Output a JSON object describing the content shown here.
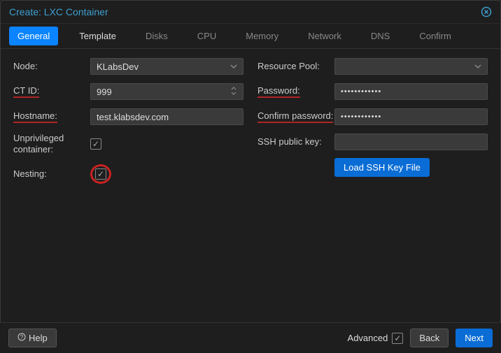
{
  "header": {
    "title": "Create: LXC Container"
  },
  "tabs": [
    "General",
    "Template",
    "Disks",
    "CPU",
    "Memory",
    "Network",
    "DNS",
    "Confirm"
  ],
  "activeTab": 0,
  "enabledTabs": [
    0,
    1
  ],
  "left": {
    "node": {
      "label": "Node:",
      "value": "KLabsDev"
    },
    "ctid": {
      "label": "CT ID:",
      "value": "999"
    },
    "hostname": {
      "label": "Hostname:",
      "value": "test.klabsdev.com"
    },
    "unpriv": {
      "label": "Unprivileged container:",
      "checked": true
    },
    "nesting": {
      "label": "Nesting:",
      "checked": true
    }
  },
  "right": {
    "pool": {
      "label": "Resource Pool:",
      "value": ""
    },
    "password": {
      "label": "Password:",
      "value": "••••••••••••"
    },
    "confirm": {
      "label": "Confirm password:",
      "value": "••••••••••••"
    },
    "sshkey": {
      "label": "SSH public key:",
      "value": ""
    },
    "loadssh": {
      "label": "Load SSH Key File"
    }
  },
  "footer": {
    "help": "Help",
    "advanced": "Advanced",
    "advancedChecked": true,
    "back": "Back",
    "next": "Next"
  }
}
